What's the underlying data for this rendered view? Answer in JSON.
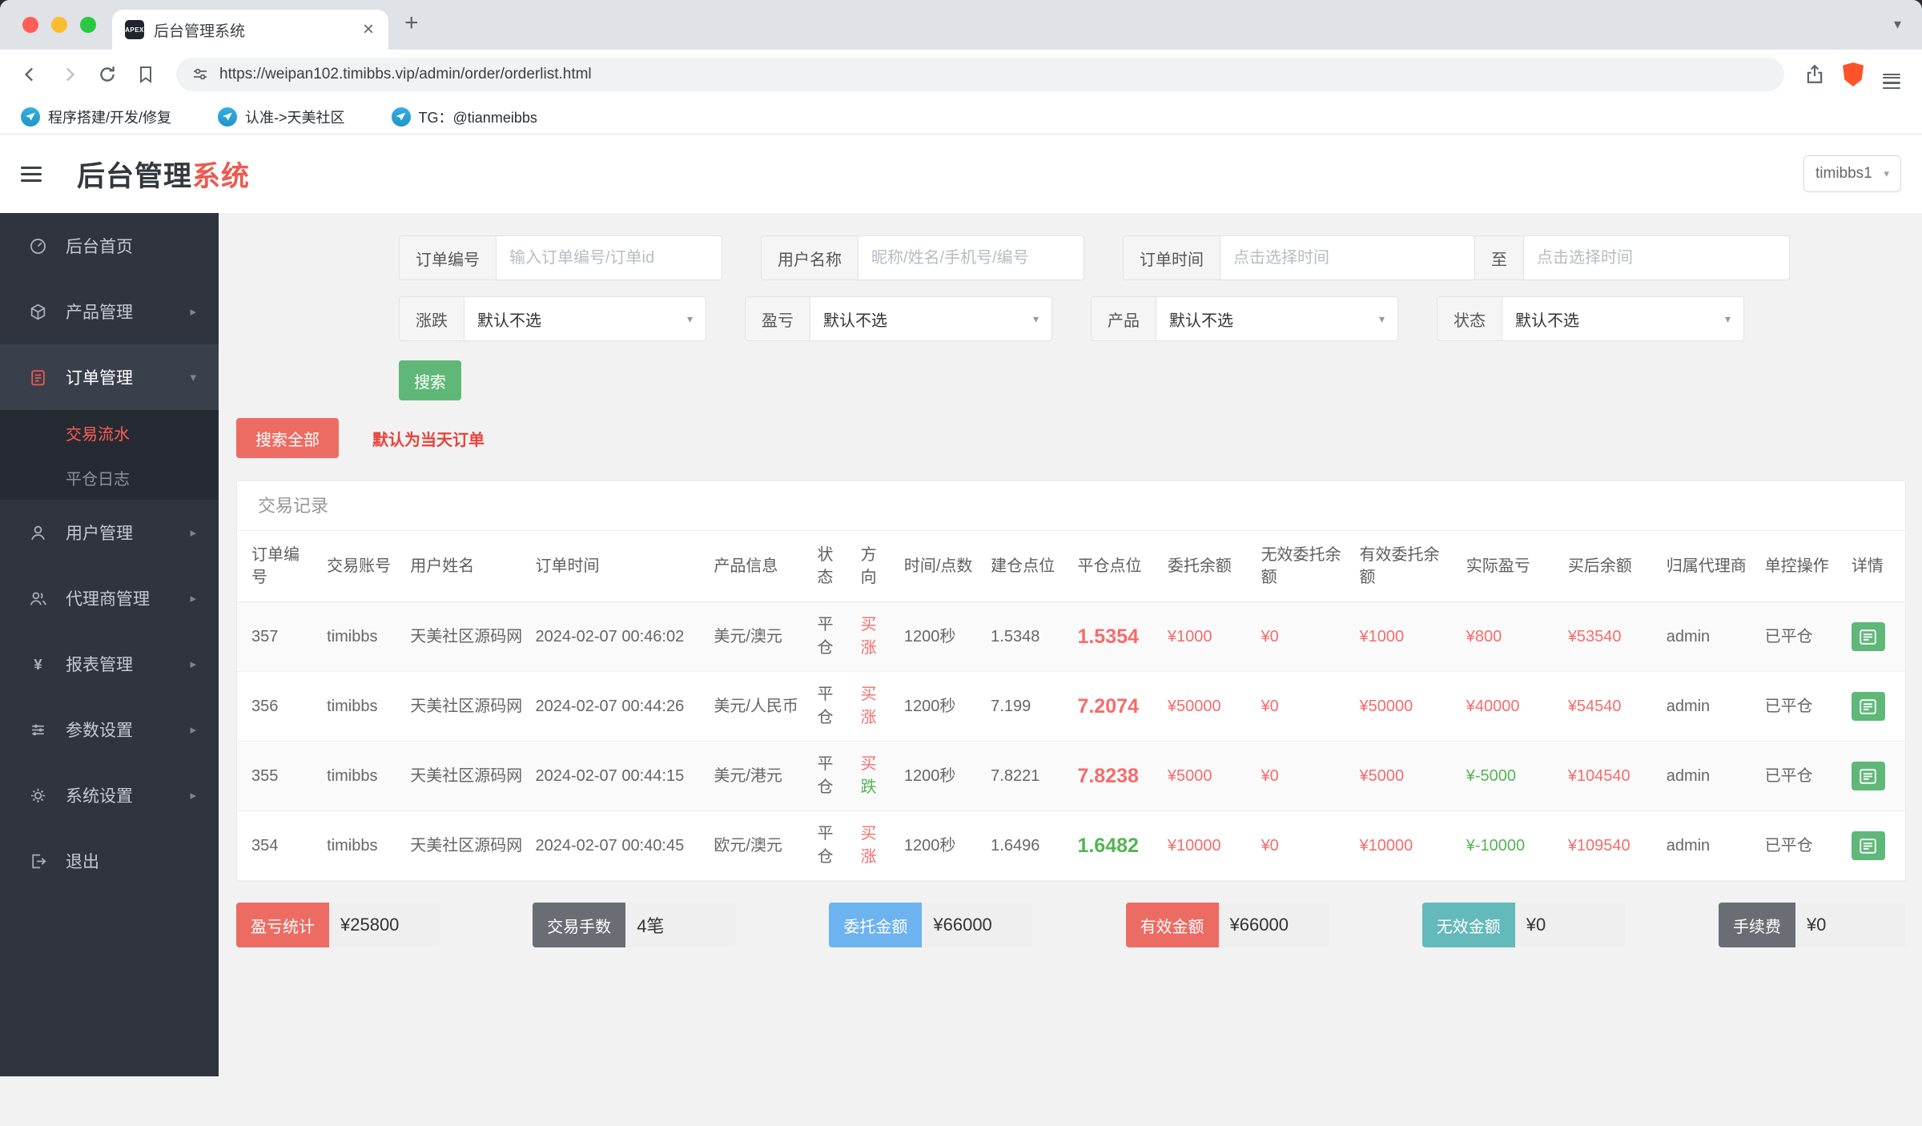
{
  "browser": {
    "tab": {
      "title": "后台管理系统",
      "favicon_text": "APEX"
    },
    "url": "https://weipan102.timibbs.vip/admin/order/orderlist.html",
    "bookmarks": [
      {
        "label": "程序搭建/开发/修复",
        "icon": "telegram-icon"
      },
      {
        "label": "认准->天美社区",
        "icon": "telegram-icon"
      },
      {
        "label": "TG：@tianmeibbs",
        "icon": "telegram-icon"
      }
    ]
  },
  "header": {
    "title_main": "后台管理",
    "title_accent": "系统",
    "user": "timibbs1"
  },
  "sidebar": {
    "items": [
      {
        "label": "后台首页",
        "icon": "dashboard-icon"
      },
      {
        "label": "产品管理",
        "icon": "product-icon"
      },
      {
        "label": "订单管理",
        "icon": "order-icon"
      },
      {
        "label": "交易流水",
        "icon": null
      },
      {
        "label": "平仓日志",
        "icon": null
      },
      {
        "label": "用户管理",
        "icon": "user-icon"
      },
      {
        "label": "代理商管理",
        "icon": "agent-icon"
      },
      {
        "label": "报表管理",
        "icon": "report-icon"
      },
      {
        "label": "参数设置",
        "icon": "params-icon"
      },
      {
        "label": "系统设置",
        "icon": "system-icon"
      },
      {
        "label": "退出",
        "icon": "logout-icon"
      }
    ]
  },
  "filters": {
    "order_no": {
      "label": "订单编号",
      "placeholder": "输入订单编号/订单id"
    },
    "user": {
      "label": "用户名称",
      "placeholder": "昵称/姓名/手机号/编号"
    },
    "time": {
      "label": "订单时间",
      "placeholder_start": "点击选择时间",
      "to": "至",
      "placeholder_end": "点击选择时间"
    },
    "updown": {
      "label": "涨跌",
      "value": "默认不选"
    },
    "profit": {
      "label": "盈亏",
      "value": "默认不选"
    },
    "product": {
      "label": "产品",
      "value": "默认不选"
    },
    "status": {
      "label": "状态",
      "value": "默认不选"
    },
    "search": "搜索",
    "search_all": "搜索全部",
    "hint": "默认为当天订单"
  },
  "panel": {
    "title": "交易记录"
  },
  "table": {
    "headers": [
      "订单编号",
      "交易账号",
      "用户姓名",
      "订单时间",
      "产品信息",
      "状态",
      "方向",
      "时间/点数",
      "建仓点位",
      "平仓点位",
      "委托余额",
      "无效委托余额",
      "有效委托余额",
      "实际盈亏",
      "买后余额",
      "归属代理商",
      "单控操作",
      "详情"
    ],
    "rows": [
      {
        "id": "357",
        "account": "timibbs",
        "name": "天美社区源码网",
        "time": "2024-02-07 00:46:02",
        "product": "美元/澳元",
        "status": "平仓",
        "dir_buy": "买",
        "dir_type": "涨",
        "duration": "1200秒",
        "open": "1.5348",
        "close": "1.5354",
        "entrust": "¥1000",
        "invalid": "¥0",
        "valid": "¥1000",
        "profit": "¥800",
        "balance": "¥53540",
        "agent": "admin",
        "control": "已平仓"
      },
      {
        "id": "356",
        "account": "timibbs",
        "name": "天美社区源码网",
        "time": "2024-02-07 00:44:26",
        "product": "美元/人民币",
        "status": "平仓",
        "dir_buy": "买",
        "dir_type": "涨",
        "duration": "1200秒",
        "open": "7.199",
        "close": "7.2074",
        "entrust": "¥50000",
        "invalid": "¥0",
        "valid": "¥50000",
        "profit": "¥40000",
        "balance": "¥54540",
        "agent": "admin",
        "control": "已平仓"
      },
      {
        "id": "355",
        "account": "timibbs",
        "name": "天美社区源码网",
        "time": "2024-02-07 00:44:15",
        "product": "美元/港元",
        "status": "平仓",
        "dir_buy": "买",
        "dir_type": "跌",
        "duration": "1200秒",
        "open": "7.8221",
        "close": "7.8238",
        "entrust": "¥5000",
        "invalid": "¥0",
        "valid": "¥5000",
        "profit": "¥-5000",
        "balance": "¥104540",
        "agent": "admin",
        "control": "已平仓"
      },
      {
        "id": "354",
        "account": "timibbs",
        "name": "天美社区源码网",
        "time": "2024-02-07 00:40:45",
        "product": "欧元/澳元",
        "status": "平仓",
        "dir_buy": "买",
        "dir_type": "涨",
        "duration": "1200秒",
        "open": "1.6496",
        "close": "1.6482",
        "entrust": "¥10000",
        "invalid": "¥0",
        "valid": "¥10000",
        "profit": "¥-10000",
        "balance": "¥109540",
        "agent": "admin",
        "control": "已平仓"
      }
    ]
  },
  "summary": [
    {
      "label": "盈亏统计",
      "value": "¥25800",
      "color": "red"
    },
    {
      "label": "交易手数",
      "value": "4笔",
      "color": "dark"
    },
    {
      "label": "委托金额",
      "value": "¥66000",
      "color": "blue"
    },
    {
      "label": "有效金额",
      "value": "¥66000",
      "color": "red"
    },
    {
      "label": "无效金额",
      "value": "¥0",
      "color": "teal"
    },
    {
      "label": "手续费",
      "value": "¥0",
      "color": "dark"
    }
  ],
  "colors": {
    "accent_red": "#ec6c63",
    "red_text": "#f56c6c",
    "green": "#5fb878",
    "green_text": "#53b553",
    "blue_label": "#6cb3f0",
    "teal_label": "#64b9ba",
    "dark_label": "#6a6d73",
    "sidebar_bg": "#30343f",
    "submenu_bg": "#262a33",
    "brave_orange": "#fb542b"
  }
}
